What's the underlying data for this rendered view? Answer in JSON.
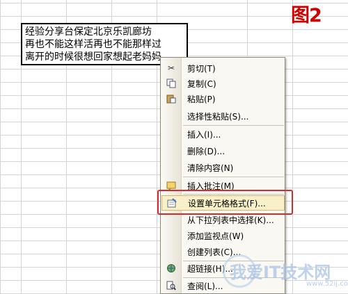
{
  "figure_label": "图2",
  "cell_lines": [
    "经验分享台保定北京乐凯廊坊",
    "再也不能这样活再也不能那样过",
    "离开的时候很想回家想起老妈妈"
  ],
  "context_menu": {
    "items": [
      {
        "label": "剪切(T)",
        "icon": "scissors-icon"
      },
      {
        "label": "复制(C)",
        "icon": "copy-icon"
      },
      {
        "label": "粘贴(P)",
        "icon": "paste-icon"
      },
      {
        "label": "选择性粘贴(S)...",
        "icon": ""
      },
      {
        "label": "插入(I)...",
        "icon": ""
      },
      {
        "label": "删除(D)...",
        "icon": ""
      },
      {
        "label": "清除内容(N)",
        "icon": ""
      },
      {
        "label": "插入批注(M)",
        "icon": "comment-icon"
      },
      {
        "label": "设置单元格格式(F)...",
        "icon": "format-cells-icon"
      },
      {
        "label": "从下拉列表中选择(K)...",
        "icon": ""
      },
      {
        "label": "添加监视点(W)",
        "icon": ""
      },
      {
        "label": "创建列表(C)...",
        "icon": ""
      },
      {
        "label": "超链接(H)...",
        "icon": "hyperlink-icon"
      },
      {
        "label": "查阅(L)...",
        "icon": "research-icon"
      }
    ]
  },
  "watermark": {
    "text": "我爱IT技术网",
    "sub": "www.52ij.com"
  },
  "colors": {
    "highlight_border": "#d42b2b",
    "figure_label": "#d10000"
  }
}
